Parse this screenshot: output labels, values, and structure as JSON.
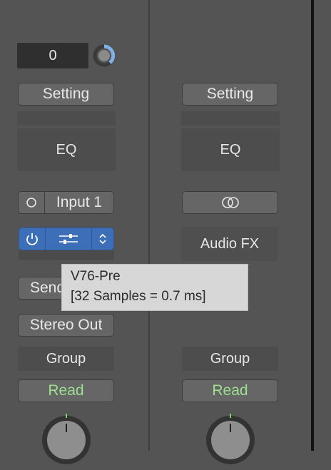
{
  "strip_left": {
    "gain_value": "0",
    "setting_label": "Setting",
    "eq_label": "EQ",
    "input_label": "Input 1",
    "sends_label": "Send",
    "output_label": "Stereo Out",
    "group_label": "Group",
    "automation_label": "Read"
  },
  "strip_right": {
    "setting_label": "Setting",
    "eq_label": "EQ",
    "audio_fx_label": "Audio FX",
    "group_label": "Group",
    "automation_label": "Read"
  },
  "tooltip": {
    "line1": "V76-Pre",
    "line2": "[32 Samples = 0.7 ms]"
  },
  "colors": {
    "background": "#545454",
    "plugin_slot_blue": "#3d6fb8",
    "automation_green": "#9be08d",
    "tooltip_bg": "#d7d7d7"
  },
  "icons": [
    "gain-knob-icon",
    "input-monitor-circle-icon",
    "stereo-link-icon",
    "power-icon",
    "sliders-icon",
    "up-down-chevron-icon",
    "pan-knob-icon"
  ]
}
